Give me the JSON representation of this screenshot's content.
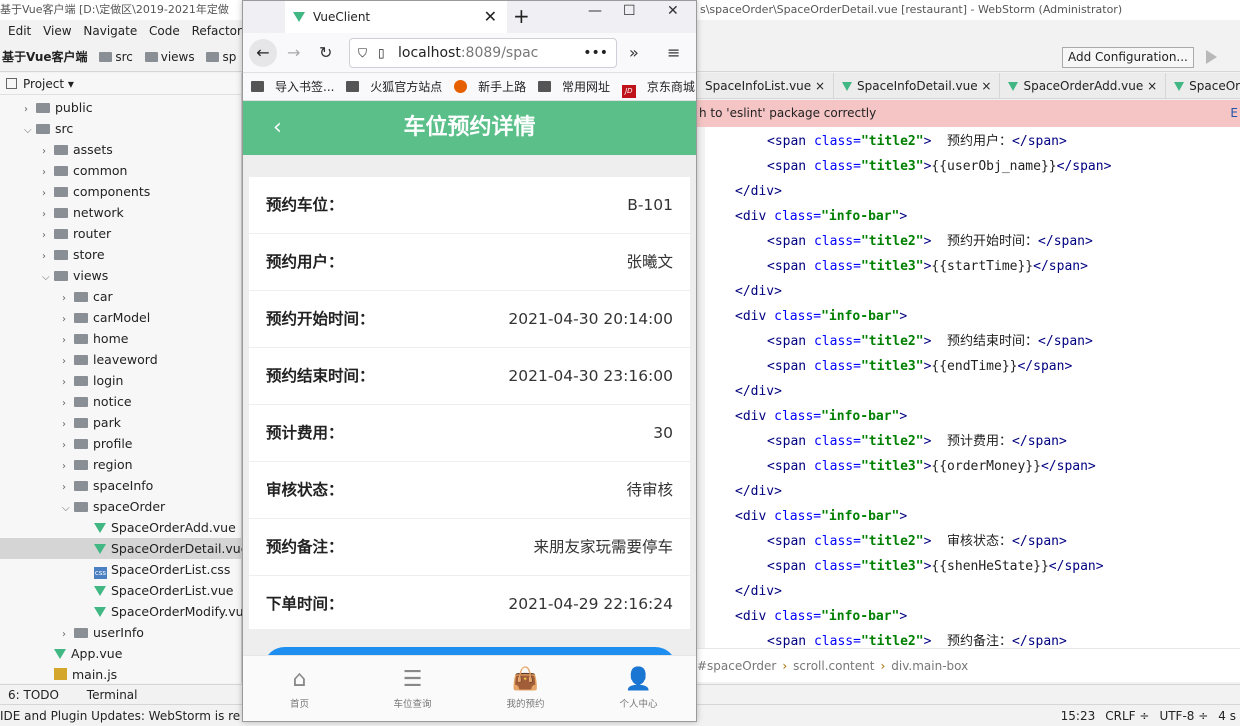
{
  "ide": {
    "title_left": "基于Vue客户端 [D:\\定做区\\2019-2021年定做",
    "title_right": "s\\spaceOrder\\SpaceOrderDetail.vue [restaurant] - WebStorm (Administrator)",
    "menu": [
      "Edit",
      "View",
      "Navigate",
      "Code",
      "Refactor"
    ],
    "breadcrumb": {
      "project": "基于Vue客户端",
      "items": [
        "src",
        "views",
        "sp"
      ]
    },
    "add_configuration": "Add Configuration...",
    "project_panel_title": "Project",
    "tree": [
      {
        "label": "public",
        "type": "folder",
        "level": 1,
        "open": false
      },
      {
        "label": "src",
        "type": "folder",
        "level": 1,
        "open": true
      },
      {
        "label": "assets",
        "type": "folder",
        "level": 2,
        "open": false
      },
      {
        "label": "common",
        "type": "folder",
        "level": 2,
        "open": false
      },
      {
        "label": "components",
        "type": "folder",
        "level": 2,
        "open": false
      },
      {
        "label": "network",
        "type": "folder",
        "level": 2,
        "open": false
      },
      {
        "label": "router",
        "type": "folder",
        "level": 2,
        "open": false
      },
      {
        "label": "store",
        "type": "folder",
        "level": 2,
        "open": false
      },
      {
        "label": "views",
        "type": "folder",
        "level": 2,
        "open": true
      },
      {
        "label": "car",
        "type": "folder",
        "level": 3,
        "open": false
      },
      {
        "label": "carModel",
        "type": "folder",
        "level": 3,
        "open": false
      },
      {
        "label": "home",
        "type": "folder",
        "level": 3,
        "open": false
      },
      {
        "label": "leaveword",
        "type": "folder",
        "level": 3,
        "open": false
      },
      {
        "label": "login",
        "type": "folder",
        "level": 3,
        "open": false
      },
      {
        "label": "notice",
        "type": "folder",
        "level": 3,
        "open": false
      },
      {
        "label": "park",
        "type": "folder",
        "level": 3,
        "open": false
      },
      {
        "label": "profile",
        "type": "folder",
        "level": 3,
        "open": false
      },
      {
        "label": "region",
        "type": "folder",
        "level": 3,
        "open": false
      },
      {
        "label": "spaceInfo",
        "type": "folder",
        "level": 3,
        "open": false
      },
      {
        "label": "spaceOrder",
        "type": "folder",
        "level": 3,
        "open": true
      },
      {
        "label": "SpaceOrderAdd.vue",
        "type": "vue",
        "level": 4
      },
      {
        "label": "SpaceOrderDetail.vue",
        "type": "vue",
        "level": 4,
        "selected": true
      },
      {
        "label": "SpaceOrderList.css",
        "type": "css",
        "level": 4
      },
      {
        "label": "SpaceOrderList.vue",
        "type": "vue",
        "level": 4
      },
      {
        "label": "SpaceOrderModify.vu",
        "type": "vue",
        "level": 4
      },
      {
        "label": "userInfo",
        "type": "folder",
        "level": 3,
        "open": false
      },
      {
        "label": "App.vue",
        "type": "vue",
        "level": 2
      },
      {
        "label": "main.js",
        "type": "js",
        "level": 2
      }
    ],
    "editor_tabs": [
      "SpaceInfoList.vue",
      "SpaceInfoDetail.vue",
      "SpaceOrderAdd.vue",
      "SpaceOrde"
    ],
    "eslint_message": "h to 'eslint' package correctly",
    "eslint_link": "E",
    "code_lines": [
      {
        "indent": 1,
        "tag": "span",
        "cls": "title2",
        "text": "预约用户：",
        "close": "span"
      },
      {
        "indent": 1,
        "tag": "span",
        "cls": "title3",
        "text": "{{userObj_name}}",
        "close": "span"
      },
      {
        "indent": 0,
        "close_only": "div"
      },
      {
        "indent": 0,
        "tag": "div",
        "cls": "info-bar",
        "open_only": true
      },
      {
        "indent": 1,
        "tag": "span",
        "cls": "title2",
        "text": "预约开始时间：",
        "close": "span"
      },
      {
        "indent": 1,
        "tag": "span",
        "cls": "title3",
        "text": "{{startTime}}",
        "close": "span"
      },
      {
        "indent": 0,
        "close_only": "div"
      },
      {
        "indent": 0,
        "tag": "div",
        "cls": "info-bar",
        "open_only": true
      },
      {
        "indent": 1,
        "tag": "span",
        "cls": "title2",
        "text": "预约结束时间：",
        "close": "span"
      },
      {
        "indent": 1,
        "tag": "span",
        "cls": "title3",
        "text": "{{endTime}}",
        "close": "span"
      },
      {
        "indent": 0,
        "close_only": "div"
      },
      {
        "indent": 0,
        "tag": "div",
        "cls": "info-bar",
        "open_only": true
      },
      {
        "indent": 1,
        "tag": "span",
        "cls": "title2",
        "text": "预计费用：",
        "close": "span"
      },
      {
        "indent": 1,
        "tag": "span",
        "cls": "title3",
        "text": "{{orderMoney}}",
        "close": "span"
      },
      {
        "indent": 0,
        "close_only": "div"
      },
      {
        "indent": 0,
        "tag": "div",
        "cls": "info-bar",
        "open_only": true
      },
      {
        "indent": 1,
        "tag": "span",
        "cls": "title2",
        "text": "审核状态：",
        "close": "span"
      },
      {
        "indent": 1,
        "tag": "span",
        "cls": "title3",
        "text": "{{shenHeState}}",
        "close": "span"
      },
      {
        "indent": 0,
        "close_only": "div"
      },
      {
        "indent": 0,
        "tag": "div",
        "cls": "info-bar",
        "open_only": true
      },
      {
        "indent": 1,
        "tag": "span",
        "cls": "title2",
        "text": "预约备注：",
        "close": "span"
      }
    ],
    "code_breadcrumb": [
      "#spaceOrder",
      "scroll.content",
      "div.main-box"
    ],
    "bottom_tabs": [
      "6: TODO",
      "Terminal"
    ],
    "status_left": "IDE and Plugin Updates: WebStorm is re",
    "status_right": [
      "15:23",
      "CRLF ÷",
      "UTF-8 ÷",
      "4 s"
    ]
  },
  "browser": {
    "tab_title": "VueClient",
    "url_host": "localhost",
    "url_rest": ":8089/spac",
    "bookmarks": [
      "导入书签...",
      "火狐官方站点",
      "新手上路",
      "常用网址",
      "京东商城"
    ],
    "jd_badge": "JD"
  },
  "app": {
    "header_title": "车位预约详情",
    "back_icon": "‹",
    "rows": [
      {
        "label": "预约车位：",
        "value": "B-101"
      },
      {
        "label": "预约用户：",
        "value": "张曦文"
      },
      {
        "label": "预约开始时间：",
        "value": "2021-04-30 20:14:00"
      },
      {
        "label": "预约结束时间：",
        "value": "2021-04-30 23:16:00"
      },
      {
        "label": "预计费用：",
        "value": "30"
      },
      {
        "label": "审核状态：",
        "value": "待审核"
      },
      {
        "label": "预约备注：",
        "value": "来朋友家玩需要停车"
      },
      {
        "label": "下单时间：",
        "value": "2021-04-29 22:16:24"
      }
    ],
    "tabbar": [
      {
        "label": "首页",
        "icon": "home-icon"
      },
      {
        "label": "车位查询",
        "icon": "list-icon"
      },
      {
        "label": "我的预约",
        "icon": "bag-icon"
      },
      {
        "label": "个人中心",
        "icon": "user-icon"
      }
    ],
    "colors": {
      "header": "#5bbf8a",
      "button": "#1f8ef1"
    }
  }
}
